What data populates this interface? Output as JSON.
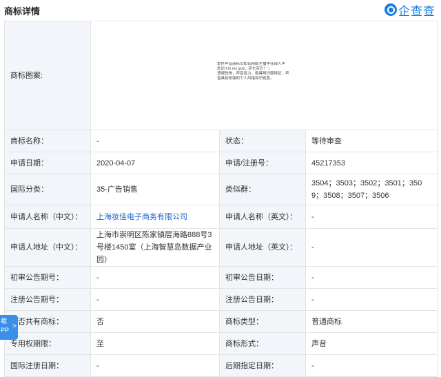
{
  "header": {
    "title": "商标详情",
    "logo_text": "企查查"
  },
  "image_row": {
    "label": "商标图案:",
    "image_lines": [
      "本件声音商标以知名网络主播李佳琦人声",
      "念出“Oh my god，买它买它！”，",
      "语速较快，声音有力，极具辨识度特征，声",
      "音具有较强的个人风格和识别度。"
    ]
  },
  "rows": [
    {
      "l1": "商标名称：",
      "v1": "-",
      "l2": "状态：",
      "v2": "等待审查"
    },
    {
      "l1": "申请日期：",
      "v1": "2020-04-07",
      "l2": "申请/注册号：",
      "v2": "45217353"
    },
    {
      "l1": "国际分类：",
      "v1": "35-广告销售",
      "l2": "类似群：",
      "v2": "3504；3503；3502；3501；3509；3508；3507；3506"
    },
    {
      "l1": "申请人名称（中文）：",
      "v1": "上海妆佳电子商务有限公司",
      "l2": "申请人名称（英文）：",
      "v2": "-"
    },
    {
      "l1": "申请人地址（中文）：",
      "v1": "上海市崇明区陈家镇层海路888号3号楼1450室（上海智慧岛数据产业园）",
      "l2": "申请人地址（英文）：",
      "v2": "-"
    },
    {
      "l1": "初审公告期号：",
      "v1": "-",
      "l2": "初审公告日期：",
      "v2": "-"
    },
    {
      "l1": "注册公告期号：",
      "v1": "-",
      "l2": "注册公告日期：",
      "v2": "-"
    },
    {
      "l1": "是否共有商标：",
      "v1": "否",
      "l2": "商标类型：",
      "v2": "普通商标"
    },
    {
      "l1": "专用权期限：",
      "v1": "至",
      "l2": "商标形式：",
      "v2": "声音"
    },
    {
      "l1": "国际注册日期：",
      "v1": "-",
      "l2": "后期指定日期：",
      "v2": "-"
    }
  ],
  "side_tab": {
    "line1": "载",
    "line2": "PP",
    "arrow": ">"
  }
}
